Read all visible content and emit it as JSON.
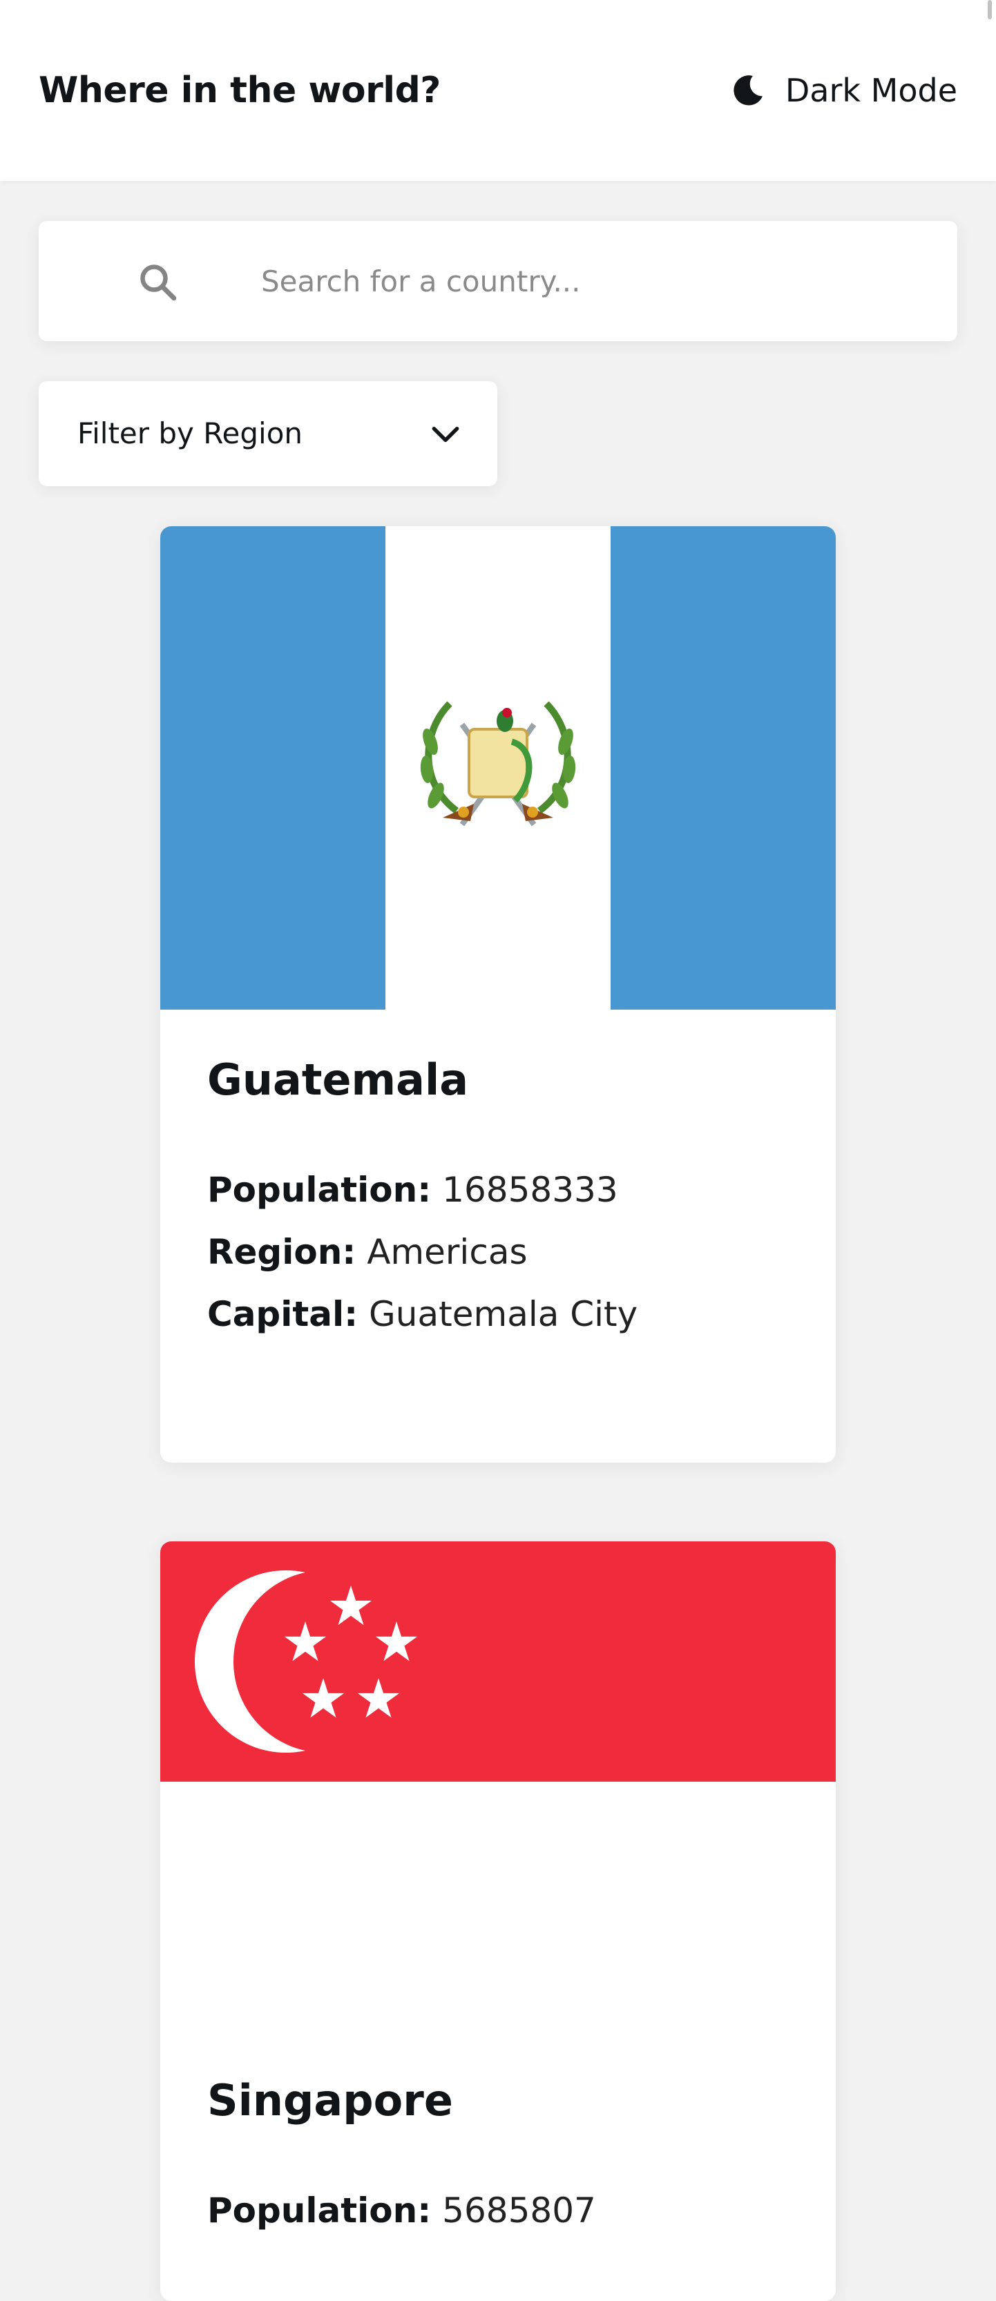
{
  "header": {
    "title": "Where in the world?",
    "theme_toggle_label": "Dark Mode",
    "theme_icon": "moon-icon"
  },
  "search": {
    "placeholder": "Search for a country...",
    "value": "",
    "icon": "search-icon"
  },
  "filter": {
    "label": "Filter by Region",
    "icon": "chevron-down-icon"
  },
  "countries": [
    {
      "name": "Guatemala",
      "flag": "guatemala-flag",
      "stats": [
        {
          "label": "Population:",
          "value": "16858333"
        },
        {
          "label": "Region:",
          "value": "Americas"
        },
        {
          "label": "Capital:",
          "value": "Guatemala City"
        }
      ]
    },
    {
      "name": "Singapore",
      "flag": "singapore-flag",
      "stats": [
        {
          "label": "Population:",
          "value": "5685807"
        }
      ]
    }
  ],
  "colors": {
    "background": "#f2f2f2",
    "surface": "#ffffff",
    "text": "#111517",
    "guatemala_blue": "#4997d0",
    "singapore_red": "#ef2b3c"
  }
}
